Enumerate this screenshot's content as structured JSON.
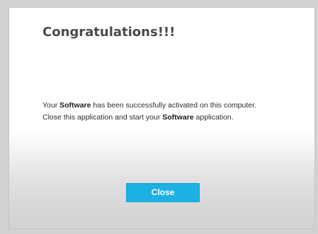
{
  "dialog": {
    "title": "Congratulations!!!",
    "line1": {
      "part1": "Your ",
      "bold1": "Software",
      "part2": " has been successfully activated on this computer."
    },
    "line2": {
      "part1": "Close this application and start your ",
      "bold1": "Software",
      "part2": " application."
    },
    "close_label": "Close"
  },
  "colors": {
    "accent": "#1db0e3",
    "title": "#4a4a4a",
    "background_bottom": "#d2d2d2"
  }
}
